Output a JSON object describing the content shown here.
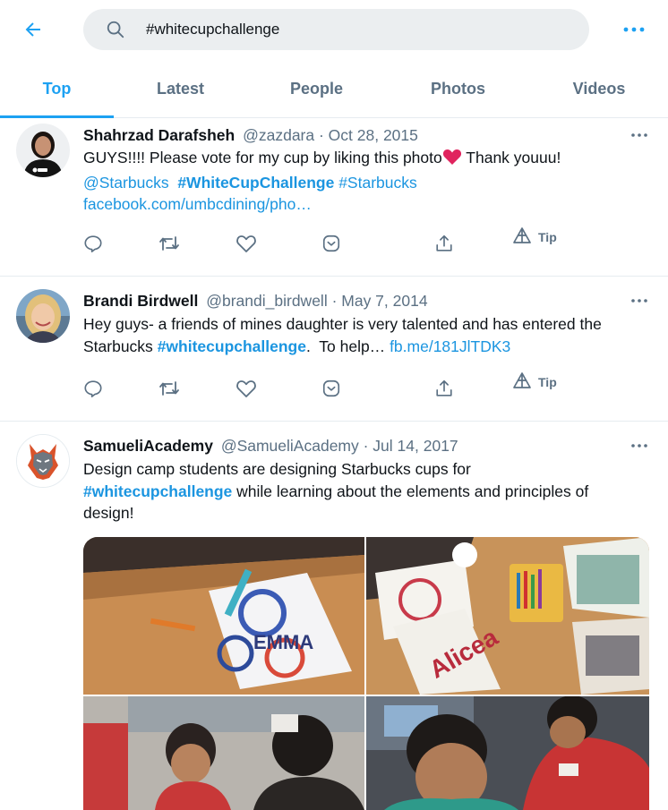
{
  "search": {
    "query": "#whitecupchallenge"
  },
  "tabs": [
    {
      "label": "Top"
    },
    {
      "label": "Latest"
    },
    {
      "label": "People"
    },
    {
      "label": "Photos"
    },
    {
      "label": "Videos"
    }
  ],
  "colors": {
    "accent": "#1da1f2",
    "link": "#1b95e0",
    "muted": "#5b7083",
    "heart": "#e0245e"
  },
  "tweets": [
    {
      "name": "Shahrzad Darafsheh",
      "meta": "@zazdara · Oct 28, 2015",
      "line1": "GUYS!!!! Please vote for my cup by liking this photo",
      "line1_after": " Thank youuu!",
      "mention": "@Starbucks",
      "hashtag1": "#WhiteCupChallenge",
      "hashtag2": "#Starbucks",
      "link": "facebook.com/umbcdining/pho…",
      "avatar_badge": "b",
      "tip_label": "Tip"
    },
    {
      "name": "Brandi Birdwell",
      "meta": "@brandi_birdwell · May 7, 2014",
      "line1": "Hey guys- a friends of mines daughter is very talented and has entered the",
      "line2_before": "Starbucks ",
      "hashtag": "#whitecupchallenge",
      "line2_after": ".  To help… ",
      "link": "fb.me/181JlTDK3",
      "tip_label": "Tip"
    },
    {
      "name": "SamueliAcademy",
      "meta": "@SamueliAcademy · Jul 14, 2017",
      "line1": "Design camp students are designing Starbucks cups for",
      "hashtag": "#whitecupchallenge",
      "line2_after": " while learning about the elements and principles of",
      "line3": "design!"
    }
  ]
}
